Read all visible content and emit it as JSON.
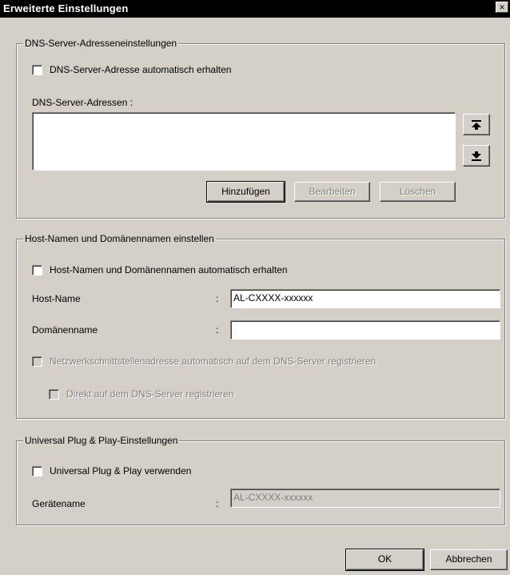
{
  "window": {
    "title": "Erweiterte Einstellungen",
    "close_glyph": "×"
  },
  "dns": {
    "legend": "DNS-Server-Adresseneinstellungen",
    "auto_label": "DNS-Server-Adresse automatisch erhalten",
    "list_label": "DNS-Server-Adressen :",
    "list_items": [],
    "move_up_icon": "move-to-top-icon",
    "move_down_icon": "move-to-bottom-icon",
    "add_button": "Hinzufügen",
    "edit_button": "Bearbeiten",
    "delete_button": "Löschen"
  },
  "host": {
    "legend": "Host-Namen und Domänennamen einstellen",
    "auto_label": "Host-Namen und Domänennamen automatisch erhalten",
    "hostname_label": "Host-Name",
    "hostname_value": "AL-CXXXX-xxxxxx",
    "domain_label": "Domänenname",
    "domain_value": "",
    "colon": ":",
    "register_label": "Netzwerkschnittstellenadresse automatisch auf dem DNS-Server registrieren",
    "direct_label": "Direkt auf dem DNS-Server registrieren"
  },
  "upnp": {
    "legend": "Universal Plug & Play-Einstellungen",
    "use_label": "Universal Plug & Play verwenden",
    "device_label": "Gerätename",
    "device_value": "AL-CXXXX-xxxxxx",
    "colon": ":"
  },
  "footer": {
    "ok": "OK",
    "cancel": "Abbrechen"
  }
}
